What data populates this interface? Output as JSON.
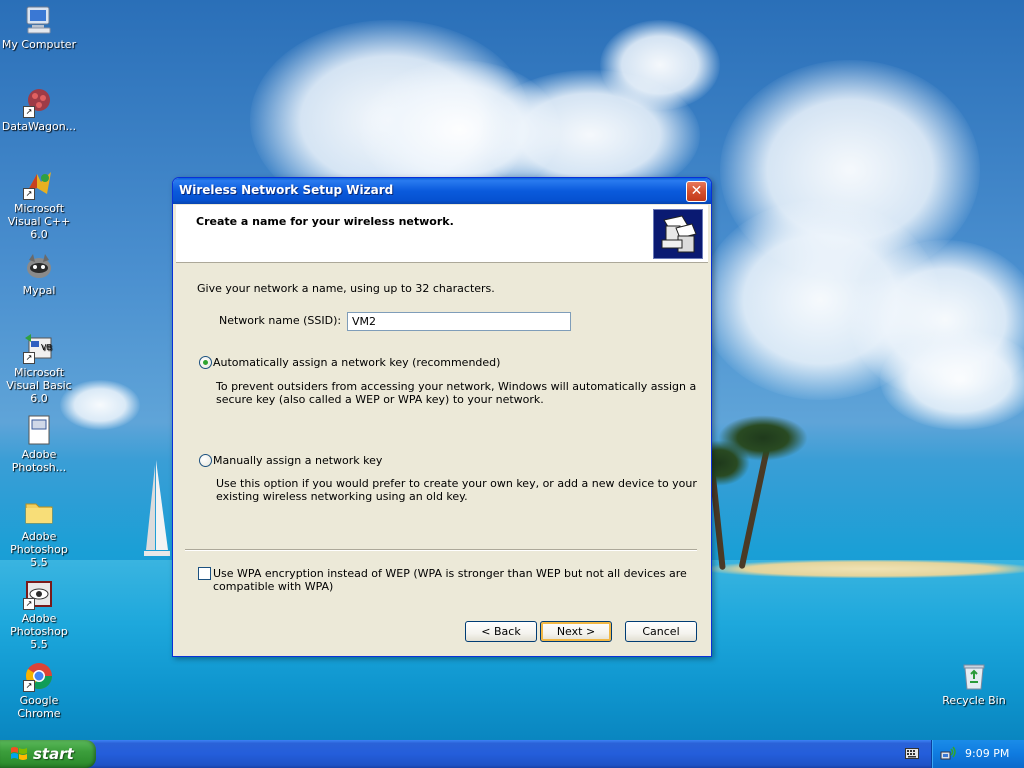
{
  "desktop": {
    "icons": [
      {
        "label": "My Computer",
        "icon": "my-computer-icon"
      },
      {
        "label": "DataWagon...",
        "icon": "datawagon-icon"
      },
      {
        "label": "Microsoft Visual C++ 6.0",
        "icon": "visual-cpp-icon"
      },
      {
        "label": "Mypal",
        "icon": "mypal-icon"
      },
      {
        "label": "Microsoft Visual Basic 6.0",
        "icon": "visual-basic-icon"
      },
      {
        "label": "Adobe Photosh...",
        "icon": "photoshop-file-icon"
      },
      {
        "label": "Adobe Photoshop 5.5",
        "icon": "folder-icon"
      },
      {
        "label": "Adobe Photoshop 5.5",
        "icon": "photoshop-eye-icon"
      },
      {
        "label": "Google Chrome",
        "icon": "chrome-icon"
      },
      {
        "label": "Recycle Bin",
        "icon": "recycle-bin-icon"
      }
    ]
  },
  "dialog": {
    "title": "Wireless Network Setup Wizard",
    "heading": "Create a name for your wireless network.",
    "intro": "Give your network a name, using up to 32 characters.",
    "ssid_label": "Network name (SSID):",
    "ssid_value": "VM2",
    "auto_option": {
      "label": "Automatically assign a network key (recommended)",
      "selected": true,
      "description_line1": "To prevent outsiders from accessing your network, Windows will automatically assign a",
      "description_line2": "secure key (also called a WEP or WPA key) to your network."
    },
    "manual_option": {
      "label": "Manually assign a network key",
      "selected": false,
      "description_line1": "Use this option if you would prefer to create your own key, or add a new device to your",
      "description_line2": "existing wireless networking using an old key."
    },
    "wpa_checkbox": {
      "label_line1": "Use WPA encryption instead of WEP (WPA is stronger than WEP but not all devices are",
      "label_line2": "compatible with WPA)",
      "checked": false
    },
    "buttons": {
      "back": "< Back",
      "next": "Next >",
      "cancel": "Cancel"
    }
  },
  "taskbar": {
    "start_label": "start",
    "clock": "9:09 PM"
  },
  "colors": {
    "title_bar": "#0a5adc",
    "dialog_bg": "#ece9d8",
    "taskbar": "#245edb",
    "start_button": "#3c9e3c",
    "radio_dot": "#2fa42f",
    "close_button": "#d4502e"
  }
}
